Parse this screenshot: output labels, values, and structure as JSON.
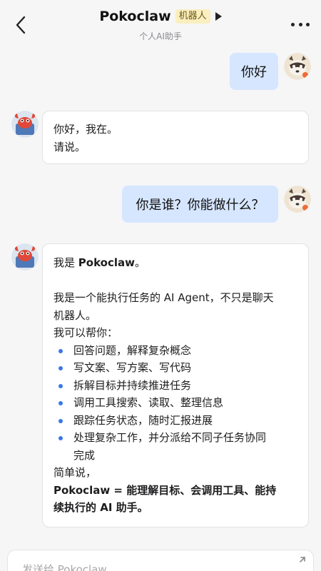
{
  "header": {
    "title": "Pokoclaw",
    "badge": "机器人",
    "subtitle": "个人AI助手",
    "back_icon": "chevron-left-icon",
    "more_icon": "more-horizontal-icon"
  },
  "messages": [
    {
      "role": "user",
      "text": "你好"
    },
    {
      "role": "bot",
      "lines": [
        "你好，我在。",
        "请说。"
      ]
    },
    {
      "role": "user",
      "text": "你是谁？你能做什么？"
    },
    {
      "role": "bot",
      "intro_prefix": "我是 ",
      "intro_name": "Pokoclaw",
      "intro_suffix": "。",
      "para1_line1": "我是一个能执行任务的 AI Agent，不只是聊天",
      "para1_line2": "机器人。",
      "help_label": "我可以帮你：",
      "bullets": [
        "回答问题，解释复杂概念",
        "写文案、写方案、写代码",
        "拆解目标并持续推进任务",
        "调用工具搜索、读取、整理信息",
        "跟踪任务状态，随时汇报进展",
        "处理复杂工作，并分派给不同子任务协同",
        "完成"
      ],
      "summary_label": "简单说，",
      "summary_line1": "Pokoclaw = 能理解目标、会调用工具、能持",
      "summary_line2": "续执行的 AI 助手。"
    }
  ],
  "composer": {
    "placeholder": "发送给 Pokoclaw",
    "expand_icon": "expand-icon"
  },
  "colors": {
    "user_bubble": "#d6e6ff",
    "bot_bubble": "#ffffff",
    "bullet": "#3a78e7",
    "badge_bg": "#fbeec0",
    "background": "#f6f6f7"
  }
}
